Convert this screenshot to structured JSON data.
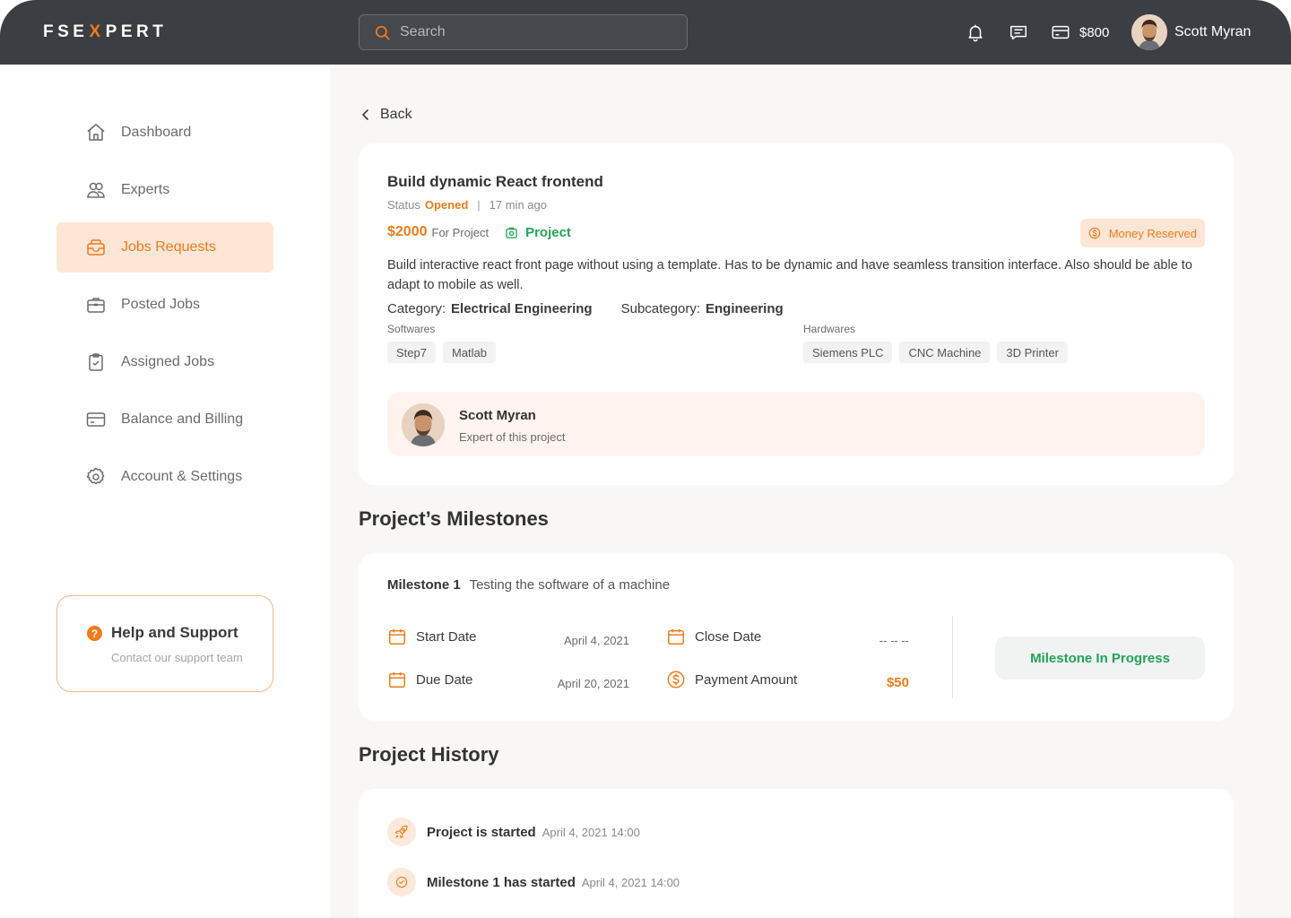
{
  "app": {
    "logo": {
      "before": "FSE",
      "mark": "X",
      "after": "PERT"
    },
    "search": {
      "placeholder": "Search"
    },
    "balance": "$800",
    "user_name": "Scott Myran",
    "colors": {
      "accent": "#f07b1c",
      "success": "#22a35a",
      "topbar": "#3b3e42"
    }
  },
  "sidebar": {
    "items": [
      {
        "label": "Dashboard",
        "icon": "home-icon"
      },
      {
        "label": "Experts",
        "icon": "users-icon"
      },
      {
        "label": "Jobs Requests",
        "icon": "inbox-icon",
        "active": true
      },
      {
        "label": "Posted Jobs",
        "icon": "briefcase-icon"
      },
      {
        "label": "Assigned Jobs",
        "icon": "clipboard-check-icon"
      },
      {
        "label": "Balance and Billing",
        "icon": "credit-card-icon"
      },
      {
        "label": "Account & Settings",
        "icon": "gear-icon"
      }
    ],
    "help": {
      "title": "Help and Support",
      "subtitle": "Contact our support team"
    }
  },
  "main": {
    "back_label": "Back",
    "job": {
      "title": "Build dynamic React frontend",
      "status_label": "Status",
      "status_value": "Opened",
      "time_ago": "17 min ago",
      "price": "$2000",
      "price_suffix": "For Project",
      "type": "Project",
      "badge": "Money Reserved",
      "description": "Build interactive react front page without using a template. Has to be dynamic and have seamless transition  interface. Also should be able to adapt to mobile as well.",
      "category_label": "Category:",
      "category_value": "Electrical Engineering",
      "subcategory_label": "Subcategory:",
      "subcategory_value": "Engineering",
      "softwares_label": "Softwares",
      "softwares": [
        "Step7",
        "Matlab"
      ],
      "hardwares_label": "Hardwares",
      "hardwares": [
        "Siemens PLC",
        "CNC Machine",
        "3D Printer"
      ],
      "expert_name": "Scott Myran",
      "expert_role": "Expert of this project"
    },
    "milestones_title": "Project’s Milestones",
    "milestone": {
      "label": "Milestone 1",
      "name": "Testing the software of a machine",
      "start_label": "Start Date",
      "start_value": "April 4, 2021",
      "due_label": "Due Date",
      "due_value": "April 20, 2021",
      "close_label": "Close Date",
      "close_value": "-- -- --",
      "payment_label": "Payment Amount",
      "payment_value": "$50",
      "status": "Milestone In Progress"
    },
    "history_title": "Project History",
    "history": [
      {
        "event": "Project is started",
        "time": "April 4, 2021 14:00",
        "icon": "rocket-icon"
      },
      {
        "event": "Milestone 1 has started",
        "time": "April 4, 2021 14:00",
        "icon": "check-circle-icon"
      }
    ]
  }
}
